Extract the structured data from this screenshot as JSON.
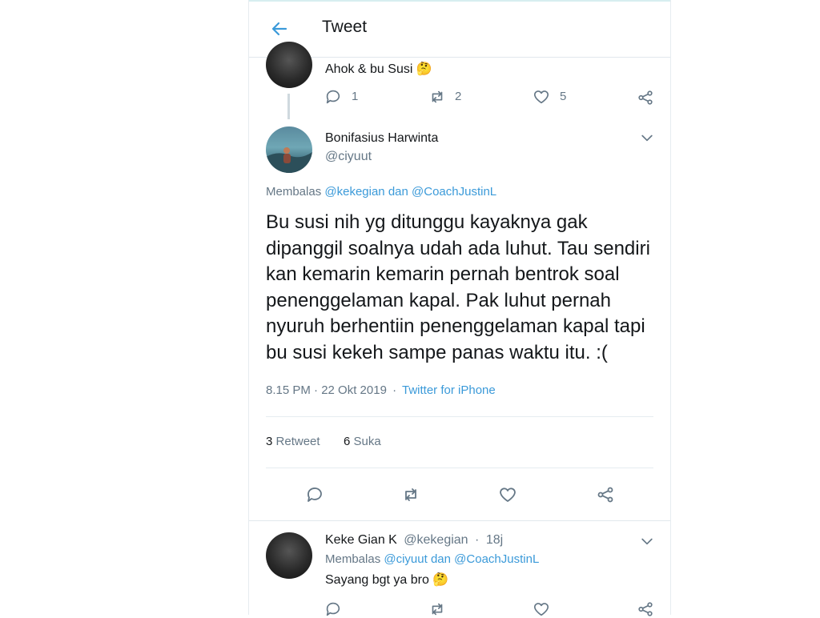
{
  "header": {
    "title": "Tweet"
  },
  "parent_tweet": {
    "text": "Ahok & bu Susi 🤔",
    "reply_count": "1",
    "retweet_count": "2",
    "like_count": "5"
  },
  "focus_tweet": {
    "name": "Bonifasius Harwinta",
    "handle": "@ciyuut",
    "replying_prefix": "Membalas",
    "replying_user1": "@kekegian",
    "replying_and": "dan",
    "replying_user2": "@CoachJustinL",
    "body": "Bu susi nih yg ditunggu kayaknya gak dipanggil soalnya udah ada luhut. Tau sendiri kan kemarin kemarin pernah bentrok soal penenggelaman kapal. Pak luhut pernah nyuruh berhentiin penenggelaman kapal tapi bu susi kekeh sampe panas waktu itu. :(",
    "timestamp": "8.15 PM · 22 Okt 2019",
    "separator": "·",
    "source": "Twitter for iPhone",
    "retweet_count": "3",
    "retweet_label": "Retweet",
    "like_count": "6",
    "like_label": "Suka"
  },
  "reply_tweet": {
    "name": "Keke Gian K",
    "handle": "@kekegian",
    "separator": "·",
    "age": "18j",
    "replying_prefix": "Membalas",
    "replying_user1": "@ciyuut",
    "replying_and": "dan",
    "replying_user2": "@CoachJustinL",
    "text": "Sayang bgt ya bro 🤔"
  },
  "colors": {
    "accent": "#3b9ad9",
    "muted": "#657786",
    "text": "#14171a",
    "border": "#e6ecf0"
  },
  "icons": [
    "back-arrow-icon",
    "reply-icon",
    "retweet-icon",
    "like-icon",
    "share-icon",
    "chevron-down-icon"
  ]
}
